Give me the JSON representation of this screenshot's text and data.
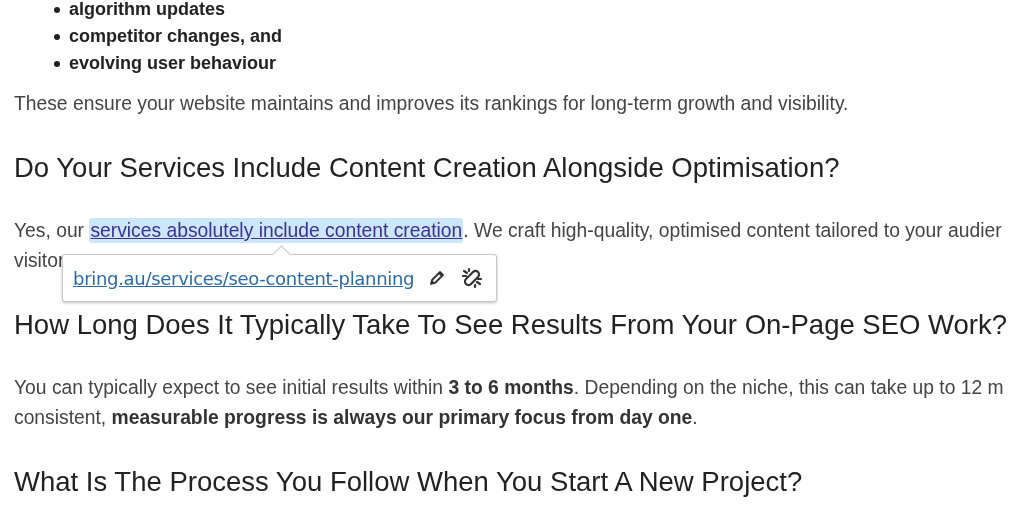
{
  "bullets": [
    "algorithm updates",
    "competitor changes, and",
    "evolving user behaviour"
  ],
  "blocks": [
    {
      "kind": "paragraph",
      "lines": [
        {
          "text": "These ensure your website maintains and improves its rankings for long-term growth and visibility."
        }
      ]
    },
    {
      "kind": "heading",
      "text": "Do Your Services Include Content Creation Alongside Optimisation?"
    },
    {
      "kind": "paragraph",
      "lines": [
        {
          "text": "Yes, our ",
          "link": {
            "text": "services absolutely include content creation",
            "selected": true
          },
          "after": ". We craft high-quality, optimised content tailored to your audier"
        },
        {
          "text": "visitor"
        }
      ]
    },
    {
      "kind": "heading",
      "text": "How Long Does It Typically Take To See Results From Your On-Page SEO Work?"
    },
    {
      "kind": "paragraph",
      "lines": [
        {
          "text": "You can typically expect to see initial results within **3 to 6 months**. Depending on the niche, this can take up to 12 m"
        },
        {
          "text": "consistent, **measurable progress is always our primary focus from day one**."
        }
      ]
    },
    {
      "kind": "heading",
      "text": "What Is The Process You Follow When You Start A New Project?"
    }
  ],
  "link_popup": {
    "url": "bring.au/services/seo-content-planning"
  }
}
